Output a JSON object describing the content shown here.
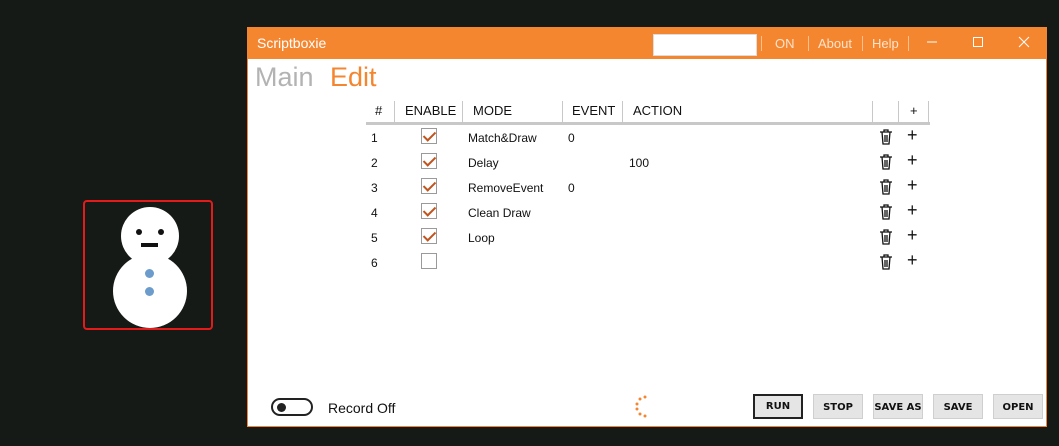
{
  "window": {
    "title": "Scriptboxie",
    "title_input_value": "",
    "toggle_on_label": "ON",
    "about_label": "About",
    "help_label": "Help",
    "minimize_icon": "minimize-icon",
    "maximize_icon": "maximize-icon",
    "close_icon": "close-icon"
  },
  "nav": {
    "main_label": "Main",
    "edit_label": "Edit"
  },
  "table": {
    "headers": {
      "num": "#",
      "enable": "ENABLE",
      "mode": "MODE",
      "event": "EVENT",
      "action": "ACTION",
      "add": "+"
    },
    "rows": [
      {
        "num": "1",
        "enabled": true,
        "mode": "Match&Draw",
        "event": "0",
        "action": ""
      },
      {
        "num": "2",
        "enabled": true,
        "mode": "Delay",
        "event": "",
        "action": "100"
      },
      {
        "num": "3",
        "enabled": true,
        "mode": "RemoveEvent",
        "event": "0",
        "action": ""
      },
      {
        "num": "4",
        "enabled": true,
        "mode": "Clean Draw",
        "event": "",
        "action": ""
      },
      {
        "num": "5",
        "enabled": true,
        "mode": "Loop",
        "event": "",
        "action": ""
      },
      {
        "num": "6",
        "enabled": false,
        "mode": "",
        "event": "",
        "action": ""
      }
    ]
  },
  "footer": {
    "record_label": "Record Off",
    "record_on": false,
    "buttons": {
      "run": "RUN",
      "stop": "STOP",
      "save_as": "SAVE AS",
      "save": "SAVE",
      "open": "OPEN"
    }
  },
  "colors": {
    "accent": "#f58630",
    "check": "#c0541e",
    "preview_border": "#e31b1b",
    "snowman_button": "#6b9ccc"
  }
}
